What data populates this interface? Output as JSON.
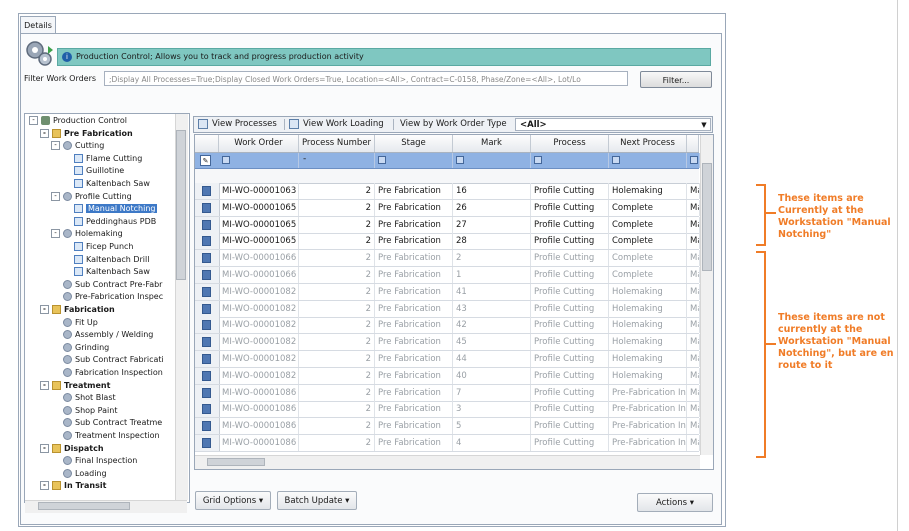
{
  "window": {
    "tab_label": "Details",
    "banner_text": "Production Control; Allows you to track and progress production activity"
  },
  "filter": {
    "label": "Filter Work Orders",
    "value": ";Display All Processes=True;Display Closed Work Orders=True, Location=<All>, Contract=C-0158, Phase/Zone=<All>, Lot/Lo",
    "button": "Filter..."
  },
  "tree": [
    {
      "label": "Production Control",
      "level": 0,
      "icon": "root-icon",
      "exp": "-",
      "bold": false
    },
    {
      "label": "Pre Fabrication",
      "level": 1,
      "icon": "folder-icon",
      "exp": "-",
      "bold": true
    },
    {
      "label": "Cutting",
      "level": 2,
      "icon": "gear-icon",
      "exp": "-",
      "bold": false
    },
    {
      "label": "Flame Cutting",
      "level": 3,
      "icon": "workstation-icon",
      "exp": "",
      "bold": false
    },
    {
      "label": "Guillotine",
      "level": 3,
      "icon": "workstation-icon",
      "exp": "",
      "bold": false
    },
    {
      "label": "Kaltenbach Saw",
      "level": 3,
      "icon": "workstation-icon",
      "exp": "",
      "bold": false
    },
    {
      "label": "Profile Cutting",
      "level": 2,
      "icon": "gear-icon",
      "exp": "-",
      "bold": false
    },
    {
      "label": "Manual Notching",
      "level": 3,
      "icon": "workstation-icon",
      "exp": "",
      "bold": false,
      "selected": true
    },
    {
      "label": "Peddinghaus PDB",
      "level": 3,
      "icon": "workstation-icon",
      "exp": "",
      "bold": false
    },
    {
      "label": "Holemaking",
      "level": 2,
      "icon": "gear-icon",
      "exp": "-",
      "bold": false
    },
    {
      "label": "Ficep Punch",
      "level": 3,
      "icon": "workstation-icon",
      "exp": "",
      "bold": false
    },
    {
      "label": "Kaltenbach Drill",
      "level": 3,
      "icon": "workstation-icon",
      "exp": "",
      "bold": false
    },
    {
      "label": "Kaltenbach Saw",
      "level": 3,
      "icon": "workstation-icon",
      "exp": "",
      "bold": false
    },
    {
      "label": "Sub Contract Pre-Fabr",
      "level": 2,
      "icon": "gear-icon",
      "exp": "",
      "bold": false
    },
    {
      "label": "Pre-Fabrication Inspec",
      "level": 2,
      "icon": "gear-icon",
      "exp": "",
      "bold": false
    },
    {
      "label": "Fabrication",
      "level": 1,
      "icon": "folder-icon",
      "exp": "-",
      "bold": true
    },
    {
      "label": "Fit Up",
      "level": 2,
      "icon": "gear-icon",
      "exp": "",
      "bold": false
    },
    {
      "label": "Assembly / Welding",
      "level": 2,
      "icon": "gear-icon",
      "exp": "",
      "bold": false
    },
    {
      "label": "Grinding",
      "level": 2,
      "icon": "gear-icon",
      "exp": "",
      "bold": false
    },
    {
      "label": "Sub Contract Fabricati",
      "level": 2,
      "icon": "gear-icon",
      "exp": "",
      "bold": false
    },
    {
      "label": "Fabrication Inspection",
      "level": 2,
      "icon": "gear-icon",
      "exp": "",
      "bold": false
    },
    {
      "label": "Treatment",
      "level": 1,
      "icon": "folder-icon",
      "exp": "-",
      "bold": true
    },
    {
      "label": "Shot Blast",
      "level": 2,
      "icon": "gear-icon",
      "exp": "",
      "bold": false
    },
    {
      "label": "Shop Paint",
      "level": 2,
      "icon": "gear-icon",
      "exp": "",
      "bold": false
    },
    {
      "label": "Sub Contract Treatme",
      "level": 2,
      "icon": "gear-icon",
      "exp": "",
      "bold": false
    },
    {
      "label": "Treatment Inspection",
      "level": 2,
      "icon": "gear-icon",
      "exp": "",
      "bold": false
    },
    {
      "label": "Dispatch",
      "level": 1,
      "icon": "folder-icon",
      "exp": "-",
      "bold": true
    },
    {
      "label": "Final Inspection",
      "level": 2,
      "icon": "gear-icon",
      "exp": "",
      "bold": false
    },
    {
      "label": "Loading",
      "level": 2,
      "icon": "gear-icon",
      "exp": "",
      "bold": false
    },
    {
      "label": "In Transit",
      "level": 1,
      "icon": "folder-icon",
      "exp": "-",
      "bold": true
    }
  ],
  "toolbar": {
    "view_processes": "View Processes",
    "view_work_loading": "View Work Loading",
    "view_by_work_order_type": "View by Work Order Type",
    "type_select": "<All>"
  },
  "grid": {
    "columns": [
      "Work Order",
      "Process Number",
      "Stage",
      "Mark",
      "Process",
      "Next Process"
    ],
    "rows": [
      {
        "wo": "MI-WO-00001063",
        "pn": "2",
        "stage": "Pre Fabrication",
        "mark": "16",
        "process": "Profile Cutting",
        "next": "Holemaking",
        "extra": "Ma",
        "dim": false
      },
      {
        "wo": "MI-WO-00001065",
        "pn": "2",
        "stage": "Pre Fabrication",
        "mark": "26",
        "process": "Profile Cutting",
        "next": "Complete",
        "extra": "Ma",
        "dim": false
      },
      {
        "wo": "MI-WO-00001065",
        "pn": "2",
        "stage": "Pre Fabrication",
        "mark": "27",
        "process": "Profile Cutting",
        "next": "Complete",
        "extra": "Ma",
        "dim": false
      },
      {
        "wo": "MI-WO-00001065",
        "pn": "2",
        "stage": "Pre Fabrication",
        "mark": "28",
        "process": "Profile Cutting",
        "next": "Complete",
        "extra": "Ma",
        "dim": false
      },
      {
        "wo": "MI-WO-00001066",
        "pn": "2",
        "stage": "Pre Fabrication",
        "mark": "2",
        "process": "Profile Cutting",
        "next": "Complete",
        "extra": "Ma",
        "dim": true
      },
      {
        "wo": "MI-WO-00001066",
        "pn": "2",
        "stage": "Pre Fabrication",
        "mark": "1",
        "process": "Profile Cutting",
        "next": "Complete",
        "extra": "Ma",
        "dim": true
      },
      {
        "wo": "MI-WO-00001082",
        "pn": "2",
        "stage": "Pre Fabrication",
        "mark": "41",
        "process": "Profile Cutting",
        "next": "Holemaking",
        "extra": "Ma",
        "dim": true
      },
      {
        "wo": "MI-WO-00001082",
        "pn": "2",
        "stage": "Pre Fabrication",
        "mark": "43",
        "process": "Profile Cutting",
        "next": "Holemaking",
        "extra": "Ma",
        "dim": true
      },
      {
        "wo": "MI-WO-00001082",
        "pn": "2",
        "stage": "Pre Fabrication",
        "mark": "42",
        "process": "Profile Cutting",
        "next": "Holemaking",
        "extra": "Ma",
        "dim": true
      },
      {
        "wo": "MI-WO-00001082",
        "pn": "2",
        "stage": "Pre Fabrication",
        "mark": "45",
        "process": "Profile Cutting",
        "next": "Holemaking",
        "extra": "Ma",
        "dim": true
      },
      {
        "wo": "MI-WO-00001082",
        "pn": "2",
        "stage": "Pre Fabrication",
        "mark": "44",
        "process": "Profile Cutting",
        "next": "Holemaking",
        "extra": "Ma",
        "dim": true
      },
      {
        "wo": "MI-WO-00001082",
        "pn": "2",
        "stage": "Pre Fabrication",
        "mark": "40",
        "process": "Profile Cutting",
        "next": "Holemaking",
        "extra": "Ma",
        "dim": true
      },
      {
        "wo": "MI-WO-00001086",
        "pn": "2",
        "stage": "Pre Fabrication",
        "mark": "7",
        "process": "Profile Cutting",
        "next": "Pre-Fabrication In",
        "extra": "Ma",
        "dim": true
      },
      {
        "wo": "MI-WO-00001086",
        "pn": "2",
        "stage": "Pre Fabrication",
        "mark": "3",
        "process": "Profile Cutting",
        "next": "Pre-Fabrication In",
        "extra": "Ma",
        "dim": true
      },
      {
        "wo": "MI-WO-00001086",
        "pn": "2",
        "stage": "Pre Fabrication",
        "mark": "5",
        "process": "Profile Cutting",
        "next": "Pre-Fabrication In",
        "extra": "Ma",
        "dim": true
      },
      {
        "wo": "MI-WO-00001086",
        "pn": "2",
        "stage": "Pre Fabrication",
        "mark": "4",
        "process": "Profile Cutting",
        "next": "Pre-Fabrication In",
        "extra": "Ma",
        "dim": true
      }
    ]
  },
  "bottom": {
    "grid_options": "Grid Options",
    "batch_update": "Batch Update",
    "actions": "Actions"
  },
  "annotations": {
    "current": "These items are Currently at the Workstation \"Manual Notching\"",
    "en_route": "These items are not currently at the Workstation \"Manual Notching\", but are en route to it"
  },
  "colors": {
    "accent_orange": "#f07c27",
    "banner_teal": "#7fc7c1",
    "filter_row_blue": "#8fb2e3"
  }
}
